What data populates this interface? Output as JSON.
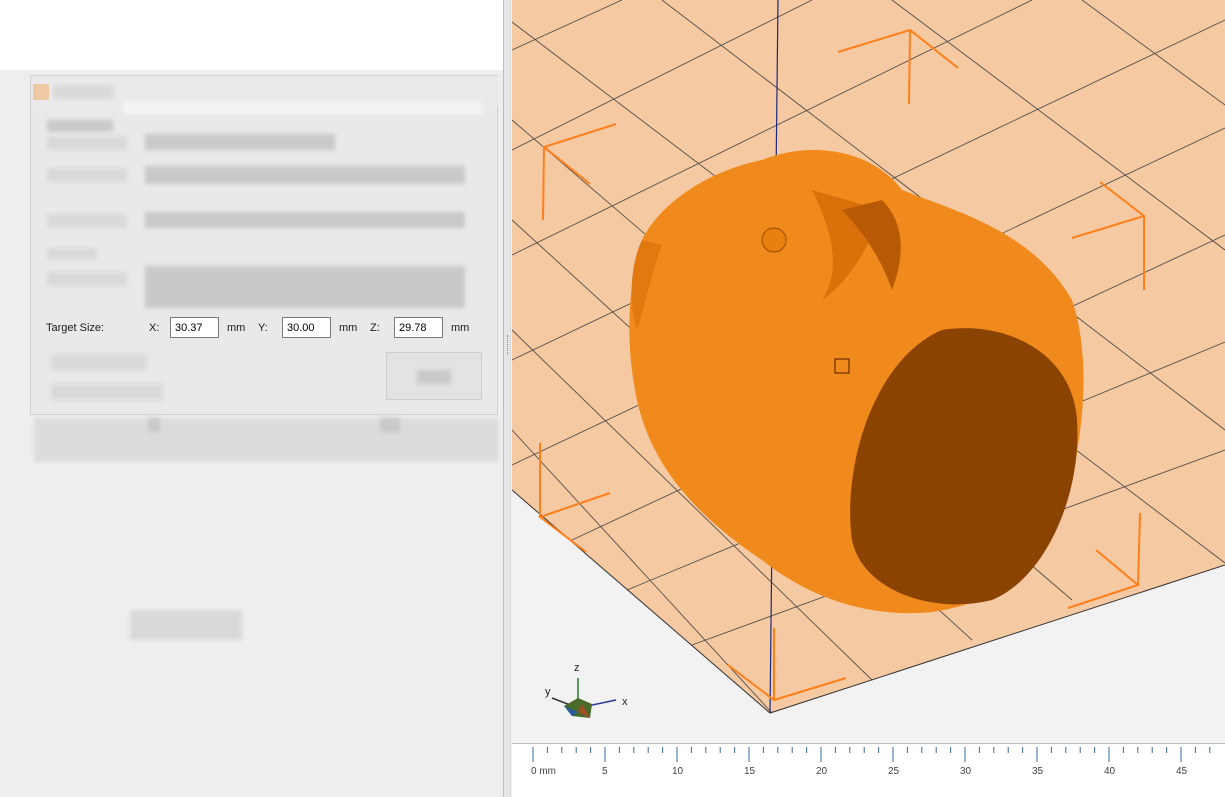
{
  "dialog": {
    "target_size_label": "Target Size:",
    "x_label": "X:",
    "x_value": "30.37",
    "y_label": "Y:",
    "y_value": "30.00",
    "z_label": "Z:",
    "z_value": "29.78",
    "unit": "mm"
  },
  "ruler": {
    "labels": [
      "0 mm",
      "5",
      "10",
      "15",
      "20",
      "25",
      "30",
      "35",
      "40",
      "45"
    ]
  },
  "axes": {
    "x": "x",
    "y": "y",
    "z": "z"
  },
  "colors": {
    "bed": "#f5c9a2",
    "model": "#f08a1c",
    "model_cut": "#8a4300",
    "marker": "#ff7f1a",
    "grid": "#3b3b3b"
  }
}
